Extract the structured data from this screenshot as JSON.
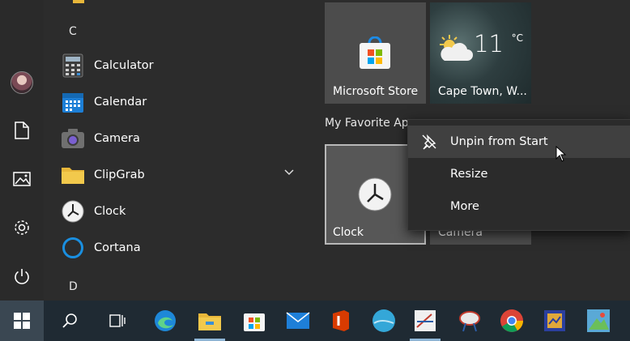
{
  "rail": {
    "items": [
      {
        "icon": "user-avatar"
      },
      {
        "icon": "document-icon"
      },
      {
        "icon": "pictures-icon"
      },
      {
        "icon": "gear-icon"
      },
      {
        "icon": "power-icon"
      }
    ]
  },
  "applist": {
    "letters": [
      "C",
      "D"
    ],
    "apps": [
      {
        "label": "Calculator",
        "icon": "calculator-icon"
      },
      {
        "label": "Calendar",
        "icon": "calendar-icon"
      },
      {
        "label": "Camera",
        "icon": "camera-icon"
      },
      {
        "label": "ClipGrab",
        "icon": "folder-icon"
      },
      {
        "label": "Clock",
        "icon": "clock-icon"
      },
      {
        "label": "Cortana",
        "icon": "cortana-icon"
      }
    ]
  },
  "tiles": {
    "store_label": "Microsoft Store",
    "weather_label": "Cape Town, W...",
    "weather_temp": "11",
    "weather_unit": "°C",
    "group_title": "My Favorite App",
    "clock_label": "Clock",
    "camera_label": "Camera"
  },
  "context_menu": {
    "items": [
      "Unpin from Start",
      "Resize",
      "More"
    ]
  },
  "taskbar": {
    "items": [
      "start-icon",
      "search-icon",
      "task-view-icon",
      "edge-icon",
      "file-explorer-icon",
      "store-icon",
      "mail-icon",
      "office-icon",
      "app-icon",
      "app-icon",
      "app-icon",
      "chrome-icon",
      "app-icon",
      "app-icon"
    ]
  }
}
